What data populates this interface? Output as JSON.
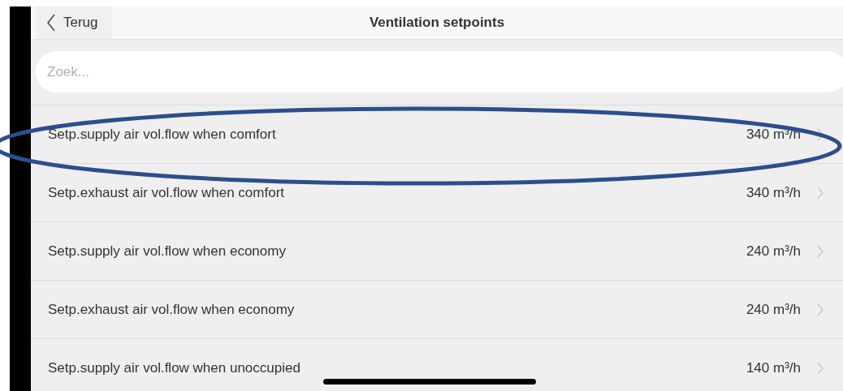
{
  "header": {
    "back_label": "Terug",
    "title": "Ventilation setpoints"
  },
  "search": {
    "placeholder": "Zoek..."
  },
  "rows": [
    {
      "label": "Setp.supply air vol.flow when comfort",
      "value": "340 m³/h"
    },
    {
      "label": "Setp.exhaust air vol.flow when comfort",
      "value": "340 m³/h"
    },
    {
      "label": "Setp.supply air vol.flow when economy",
      "value": "240 m³/h"
    },
    {
      "label": "Setp.exhaust air vol.flow when economy",
      "value": "240 m³/h"
    },
    {
      "label": "Setp.supply air vol.flow when unoccupied",
      "value": "140 m³/h"
    }
  ]
}
